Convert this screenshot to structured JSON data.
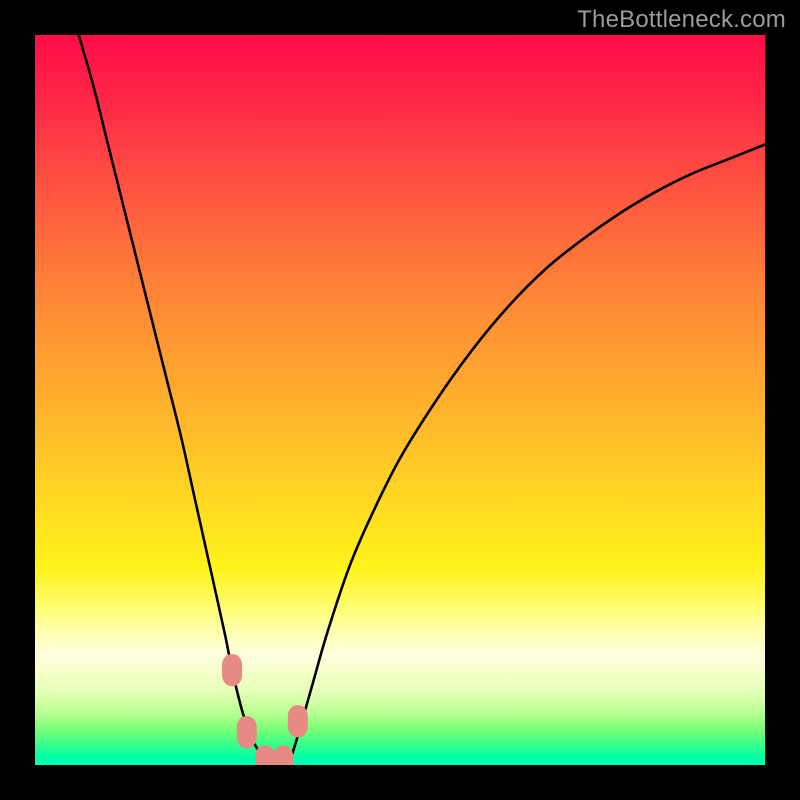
{
  "watermark": "TheBottleneck.com",
  "colors": {
    "frame": "#000000",
    "curve": "#000000",
    "marker_fill": "#e78a84",
    "marker_stroke": "#d4736d"
  },
  "chart_data": {
    "type": "line",
    "title": "",
    "xlabel": "",
    "ylabel": "",
    "xlim": [
      0,
      100
    ],
    "ylim": [
      0,
      100
    ],
    "grid": false,
    "series": [
      {
        "name": "bottleneck-curve",
        "x": [
          6,
          8,
          10,
          12,
          14,
          16,
          18,
          20,
          22,
          24,
          26,
          27,
          28.5,
          30,
          31.5,
          33,
          34,
          35,
          36,
          38,
          40,
          43,
          46,
          50,
          55,
          60,
          65,
          70,
          75,
          80,
          85,
          90,
          95,
          100
        ],
        "y": [
          100,
          93,
          85,
          77,
          69,
          61,
          53,
          45,
          36,
          27,
          18,
          13,
          7,
          3,
          1,
          0,
          0,
          1,
          4,
          11,
          18,
          27,
          34,
          42,
          50,
          57,
          63,
          68,
          72,
          75.5,
          78.5,
          81,
          83,
          85
        ]
      }
    ],
    "markers": [
      {
        "name": "left-upper",
        "x": 27.0,
        "y": 13.0
      },
      {
        "name": "left-lower",
        "x": 29.0,
        "y": 4.5
      },
      {
        "name": "valley",
        "x": 31.5,
        "y": 0.5
      },
      {
        "name": "right-lower",
        "x": 34.0,
        "y": 0.5
      },
      {
        "name": "right-upper",
        "x": 36.0,
        "y": 6.0
      }
    ]
  }
}
